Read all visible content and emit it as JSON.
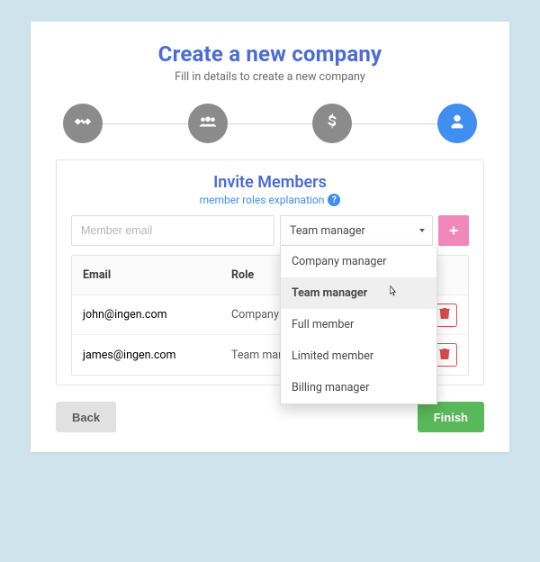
{
  "header": {
    "title": "Create a new company",
    "subtitle": "Fill in details to create a new company"
  },
  "steps": [
    {
      "icon": "handshake-icon",
      "state": "done"
    },
    {
      "icon": "people-icon",
      "state": "done"
    },
    {
      "icon": "dollar-icon",
      "state": "done"
    },
    {
      "icon": "person-icon",
      "state": "active"
    }
  ],
  "panel": {
    "title": "Invite Members",
    "help_link": "member roles explanation"
  },
  "invite": {
    "email_placeholder": "Member email",
    "email_value": "",
    "role_selected": "Team manager",
    "dropdown_open": true,
    "role_options": [
      {
        "label": "Company manager",
        "hovered": false
      },
      {
        "label": "Team manager",
        "hovered": true
      },
      {
        "label": "Full member",
        "hovered": false
      },
      {
        "label": "Limited member",
        "hovered": false
      },
      {
        "label": "Billing manager",
        "hovered": false
      }
    ]
  },
  "table": {
    "columns": {
      "email": "Email",
      "role": "Role"
    },
    "rows": [
      {
        "email": "john@ingen.com",
        "role": "Company manager"
      },
      {
        "email": "james@ingen.com",
        "role": "Team manager"
      }
    ]
  },
  "footer": {
    "back": "Back",
    "finish": "Finish"
  },
  "colors": {
    "accent": "#4a6cd4",
    "primary": "#3f8ef0",
    "pink": "#f288b9",
    "success": "#59b859",
    "danger": "#d94b4b"
  }
}
